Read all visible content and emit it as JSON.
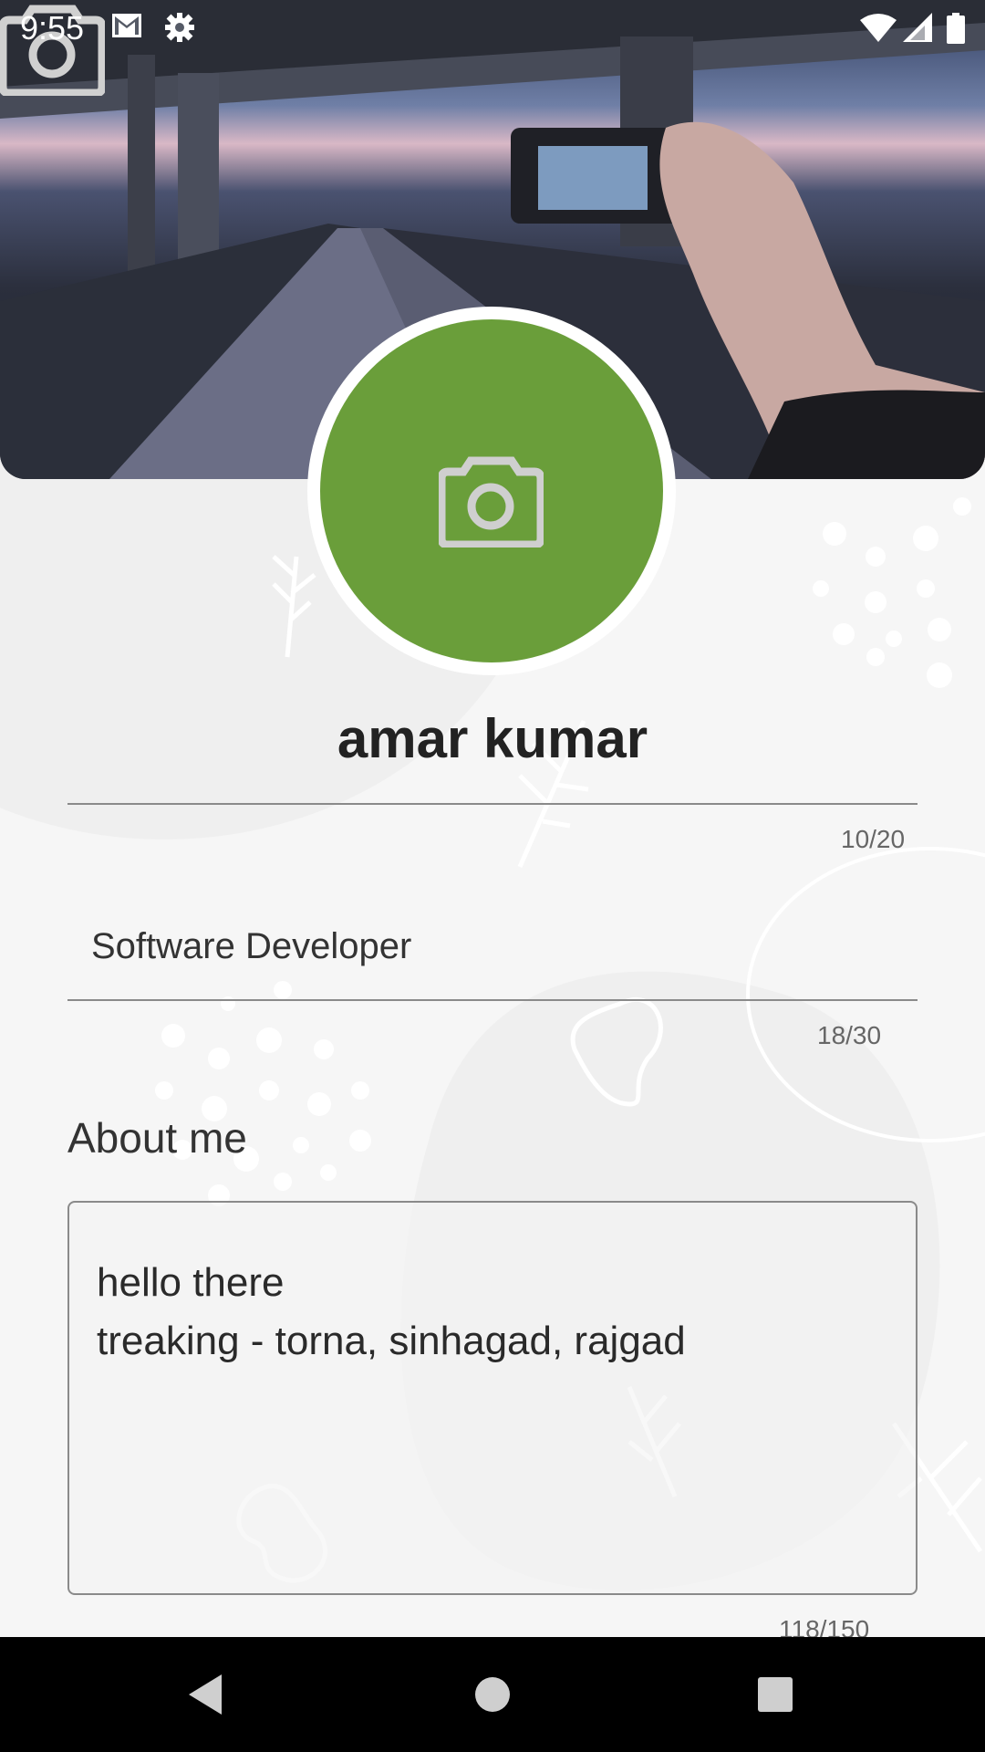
{
  "status_bar": {
    "time": "9:55",
    "icons": [
      "gmail-icon",
      "settings-gear-icon",
      "wifi-icon",
      "cell-signal-icon",
      "battery-icon"
    ]
  },
  "profile": {
    "name": "amar kumar",
    "name_counter": "10/20",
    "title": "Software Developer",
    "title_counter": "18/30",
    "about_label": "About me",
    "about_text": "hello there\ntreaking - torna, sinhagad, rajgad",
    "about_counter": "118/150"
  },
  "colors": {
    "avatar_bg": "#6a9e3a",
    "page_bg": "#f6f6f6",
    "nav_bg": "#000000"
  },
  "nav_bar": {
    "icons": [
      "back-icon",
      "home-icon",
      "recents-icon"
    ]
  }
}
